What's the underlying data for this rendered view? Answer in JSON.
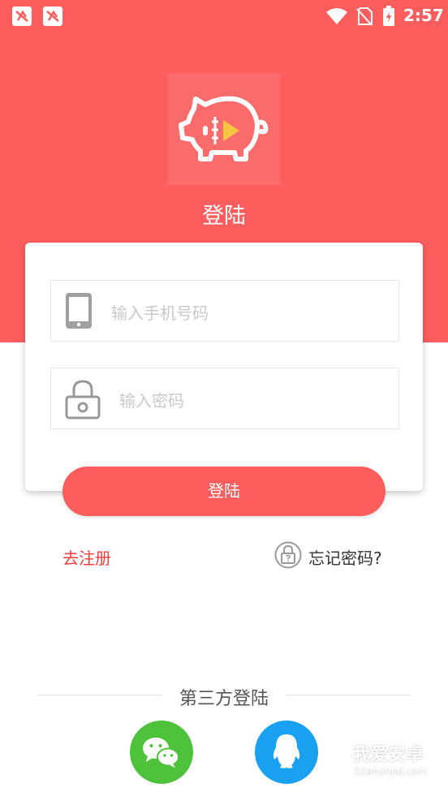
{
  "status_bar": {
    "time": "2:57",
    "icons": [
      "notification-app-icon",
      "notification-app-icon",
      "wifi-icon",
      "no-sim-icon",
      "battery-charging-icon"
    ]
  },
  "header": {
    "title": "登陆",
    "logo": "piggy-bank-video-logo"
  },
  "login_form": {
    "phone_placeholder": "输入手机号码",
    "phone_icon": "phone-icon",
    "password_placeholder": "输入密码",
    "password_icon": "lock-icon",
    "submit_label": "登陆"
  },
  "links": {
    "register": "去注册",
    "forgot_password": "忘记密码?",
    "forgot_icon": "lock-question-icon"
  },
  "third_party": {
    "title": "第三方登陆",
    "providers": [
      {
        "name": "wechat",
        "icon": "wechat-icon",
        "color": "#4fc23b"
      },
      {
        "name": "qq",
        "icon": "qq-icon",
        "color": "#1aa0f0"
      }
    ]
  },
  "watermark": {
    "text": "我爱安卓",
    "subtext": "52android.com"
  },
  "colors": {
    "accent": "#fd5d5d",
    "register_link": "#f23d3d"
  }
}
